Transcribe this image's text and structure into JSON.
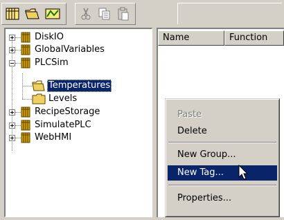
{
  "toolbar": {
    "buttons": [
      {
        "icon": "tag-database-icon"
      },
      {
        "icon": "open-folder-icon"
      },
      {
        "icon": "trend-chart-icon"
      },
      {
        "icon": "cut-icon"
      },
      {
        "icon": "copy-icon"
      },
      {
        "icon": "paste-icon"
      }
    ]
  },
  "tree": {
    "nodes": [
      {
        "label": "DiskIO",
        "icon": "tag-db-icon",
        "expanded": false
      },
      {
        "label": "GlobalVariables",
        "icon": "tag-db-icon",
        "expanded": false
      },
      {
        "label": "PLCSim",
        "icon": "tag-db-icon",
        "expanded": true
      },
      {
        "label": "Temperatures",
        "icon": "open-folder-icon",
        "selected": true
      },
      {
        "label": "Levels",
        "icon": "folder-icon"
      },
      {
        "label": "RecipeStorage",
        "icon": "tag-db-icon",
        "expanded": false
      },
      {
        "label": "SimulatePLC",
        "icon": "tag-db-icon",
        "expanded": false
      },
      {
        "label": "WebHMI",
        "icon": "tag-db-icon",
        "expanded": false
      }
    ]
  },
  "list": {
    "columns": [
      "Name",
      "Function"
    ]
  },
  "context_menu": {
    "items": [
      {
        "label": "Paste",
        "disabled": true
      },
      {
        "label": "Delete"
      },
      {
        "label": "New Group..."
      },
      {
        "label": "New Tag...",
        "highlighted": true
      },
      {
        "label": "Properties..."
      }
    ]
  },
  "colors": {
    "highlight": "#0a246a",
    "face": "#d4d0c8",
    "db_icon": "#d4a000",
    "folder": "#f0d060"
  }
}
